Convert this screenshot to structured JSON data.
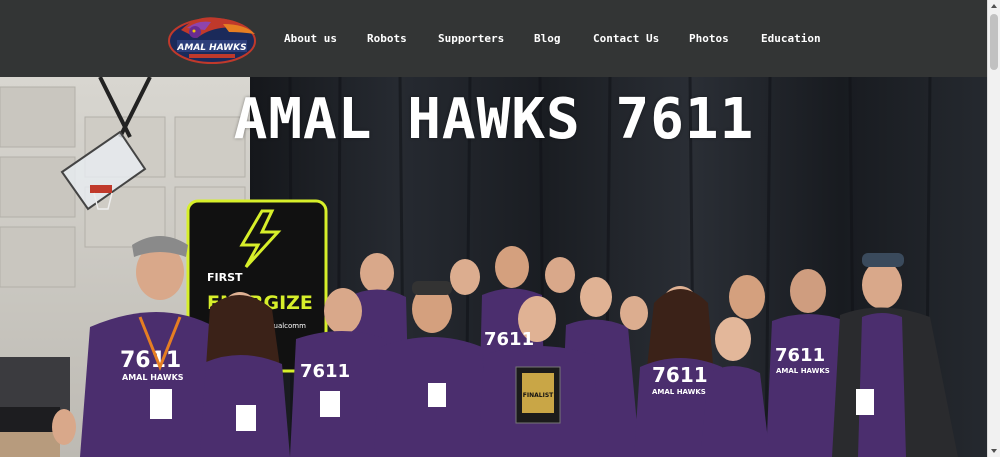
{
  "header": {
    "logo_text": "AMAL HAWKS",
    "nav": [
      {
        "label": "About us"
      },
      {
        "label": "Robots"
      },
      {
        "label": "Supporters"
      },
      {
        "label": "Blog"
      },
      {
        "label": "Contact Us"
      },
      {
        "label": "Photos"
      },
      {
        "label": "Education"
      }
    ]
  },
  "hero": {
    "title": "AMAL HAWKS 7611",
    "banner_text": "FIRST ENERGIZE",
    "banner_sub": "Qualcomm",
    "shirt_number": "7611",
    "shirt_text": "AMAL HAWKS",
    "plaque_text": "FINALIST"
  },
  "colors": {
    "header_bg": "#333535",
    "purple": "#4b2e6e",
    "banner_green": "#d7ef2a"
  }
}
